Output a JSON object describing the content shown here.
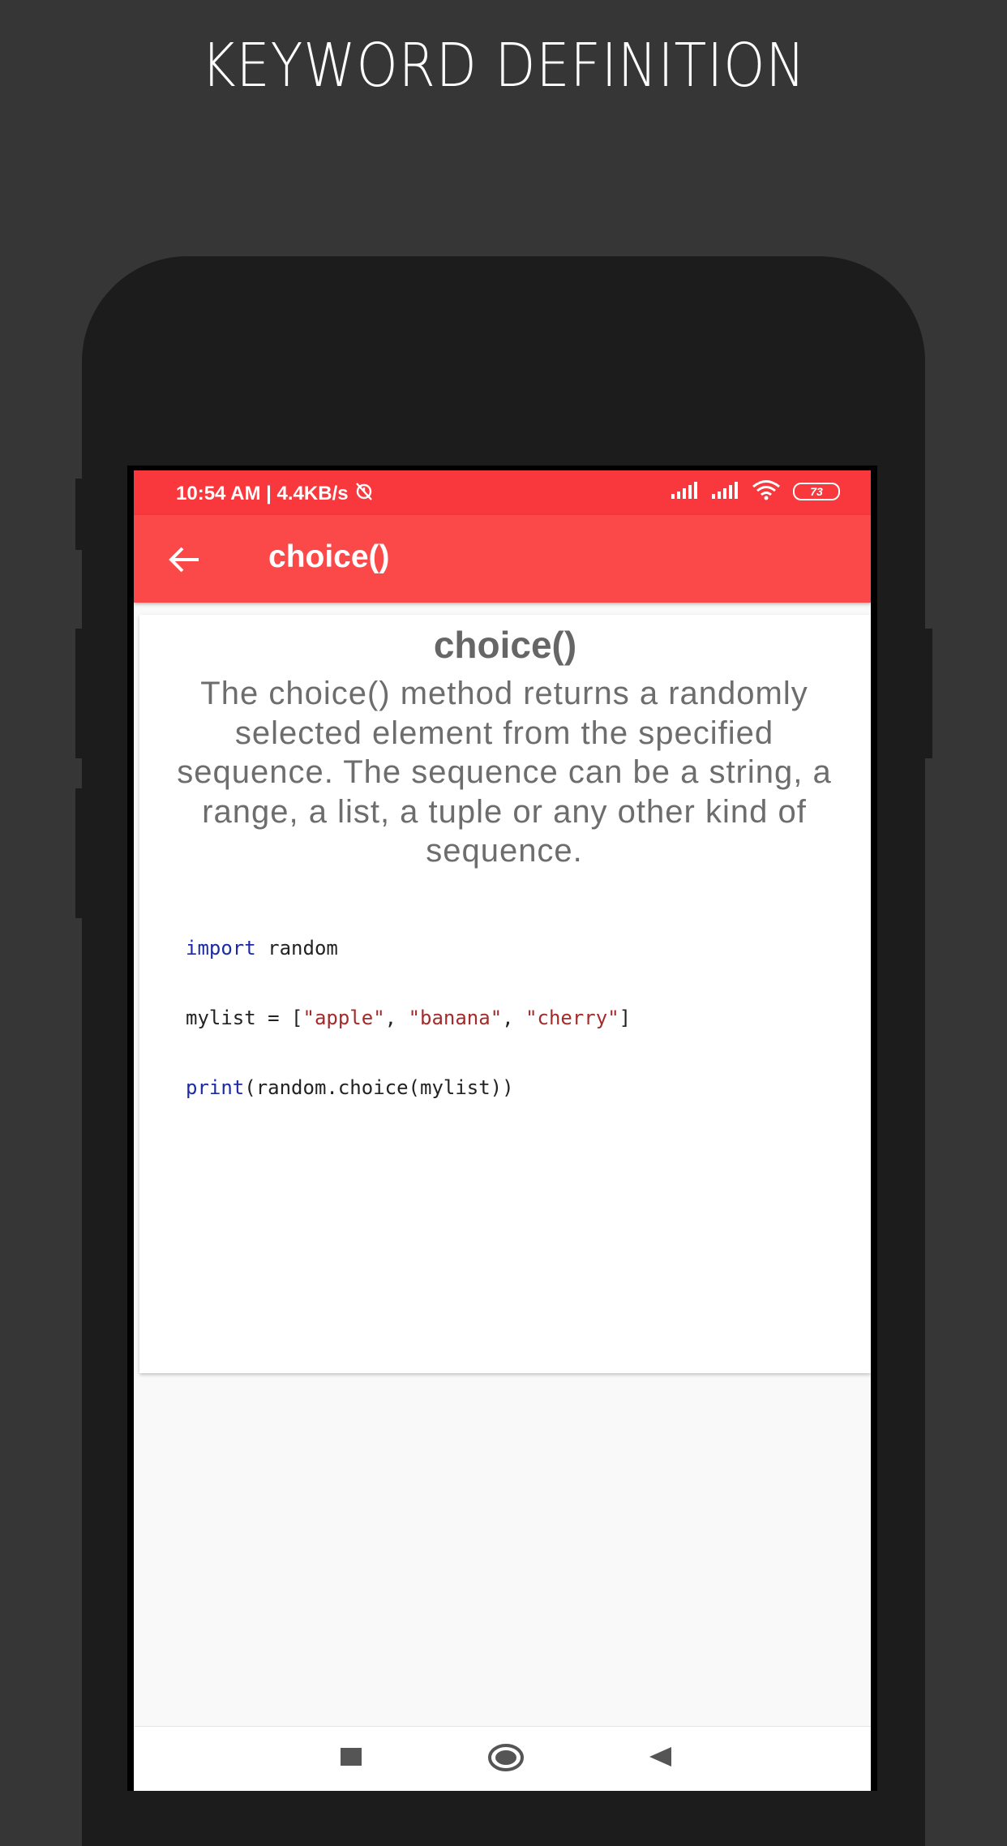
{
  "promo": {
    "title": "KEYWORD DEFINITION"
  },
  "status_bar": {
    "time_speed": "10:54 AM | 4.4KB/s",
    "battery": "73",
    "icons": [
      "alarm-off-icon",
      "signal-icon",
      "signal-icon",
      "wifi-icon",
      "battery-icon"
    ],
    "background": "#f8383c"
  },
  "app_bar": {
    "title": "choice()",
    "back_icon": "arrow-left-icon",
    "background": "#fb4849"
  },
  "definition": {
    "heading": "choice()",
    "description": "The choice() method returns a randomly selected element from the specified sequence.  The sequence can be a string, a range, a list, a tuple or any other kind of sequence.",
    "code": {
      "line1_kw": "import",
      "line1_rest": " random",
      "line2_a": "mylist = [",
      "line2_s1": "\"apple\"",
      "line2_sep1": ", ",
      "line2_s2": "\"banana\"",
      "line2_sep2": ", ",
      "line2_s3": "\"cherry\"",
      "line2_end": "]",
      "line3_kw": "print",
      "line3_rest": "(random.choice(mylist))"
    }
  },
  "nav_bar": {
    "buttons": [
      "recents-square-icon",
      "home-circle-icon",
      "back-triangle-icon"
    ]
  }
}
